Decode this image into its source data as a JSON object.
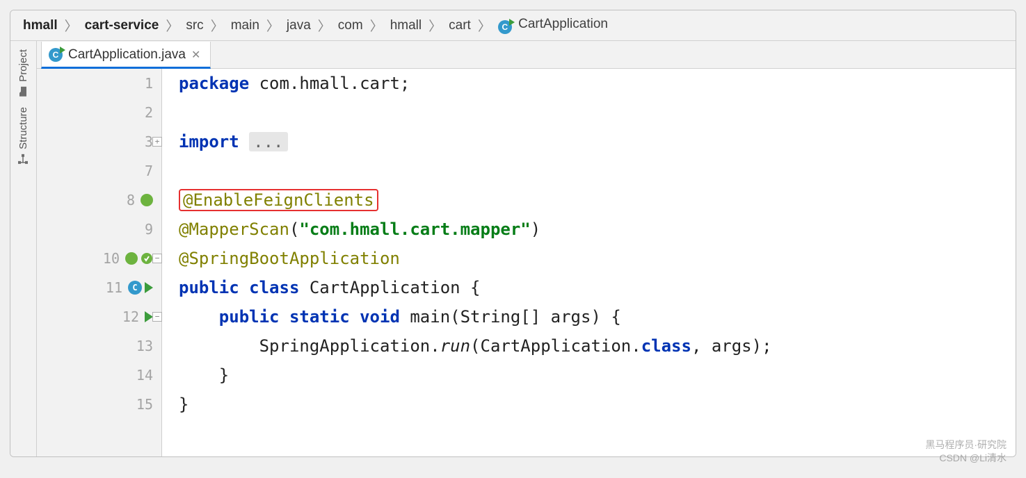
{
  "breadcrumb": {
    "items": [
      {
        "label": "hmall",
        "bold": true
      },
      {
        "label": "cart-service",
        "bold": true
      },
      {
        "label": "src",
        "bold": false
      },
      {
        "label": "main",
        "bold": false
      },
      {
        "label": "java",
        "bold": false
      },
      {
        "label": "com",
        "bold": false
      },
      {
        "label": "hmall",
        "bold": false
      },
      {
        "label": "cart",
        "bold": false
      },
      {
        "label": "CartApplication",
        "bold": false,
        "icon": "class-run-icon"
      }
    ]
  },
  "sidebar": {
    "tools": [
      {
        "name": "project",
        "label": "Project",
        "icon": "folder-icon"
      },
      {
        "name": "structure",
        "label": "Structure",
        "icon": "structure-icon"
      }
    ]
  },
  "tab": {
    "label": "CartApplication.java",
    "icon": "class-run-icon"
  },
  "code": {
    "line_numbers": [
      "1",
      "2",
      "3",
      "7",
      "8",
      "9",
      "10",
      "11",
      "12",
      "13",
      "14",
      "15"
    ],
    "pkg_keyword": "package",
    "pkg_value": " com.hmall.cart;",
    "import_keyword": "import",
    "import_ellipsis": "...",
    "anno1": "@EnableFeignClients",
    "anno2a": "@MapperScan",
    "anno2b": "(",
    "anno2c": "\"com.hmall.cart.mapper\"",
    "anno2d": ")",
    "anno3": "@SpringBootApplication",
    "public_kw": "public",
    "class_kw": "class",
    "class_name": " CartApplication {",
    "static_kw": "static",
    "void_kw": "void",
    "main_sig": " main(String[] args) {",
    "run_line_a": "        SpringApplication.",
    "run_line_b": "run",
    "run_line_c": "(CartApplication.",
    "run_line_d": "class",
    "run_line_e": ", args);",
    "close1": "    }",
    "close2": "}"
  },
  "watermark": {
    "line1": "黑马程序员·研究院",
    "line2": "CSDN @Li清水"
  }
}
